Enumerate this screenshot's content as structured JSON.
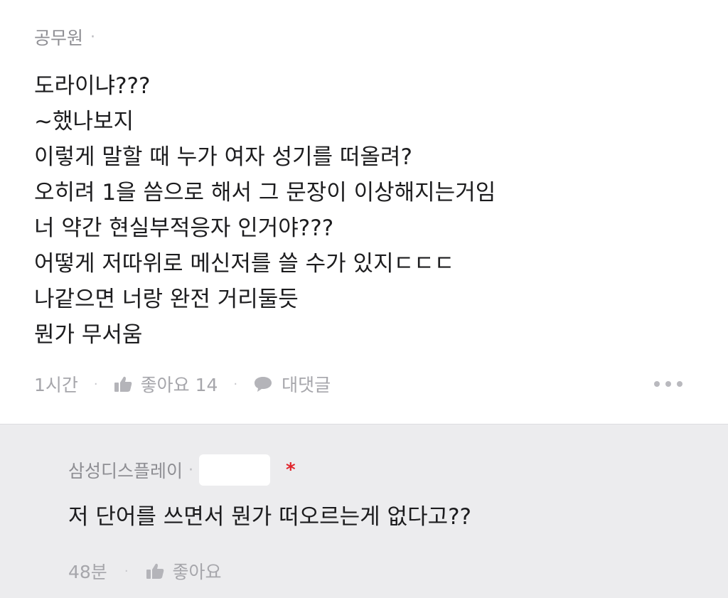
{
  "comment": {
    "author": "공무원",
    "separator": "·",
    "lines": [
      "도라이냐???",
      "~했나보지",
      "이렇게 말할 때 누가 여자 성기를 떠올려?",
      "오히려 1을 씀으로 해서 그 문장이 이상해지는거임",
      "너 약간 현실부적응자 인거야???",
      "어떻게 저따위로 메신저를 쓸 수가 있지ㄷㄷㄷ",
      "나같으면 너랑 완전 거리둘듯",
      "뭔가 무서움"
    ],
    "time": "1시간",
    "like_label": "좋아요 14",
    "reply_label": "대댓글",
    "like_icon": "thumbs-up-icon",
    "reply_icon": "speech-bubble-icon",
    "more_icon": "more-horizontal-icon"
  },
  "reply": {
    "author": "삼성디스플레이",
    "separator": "·",
    "verified_mark": "*",
    "text": "저 단어를 쓰면서 뭔가 떠오르는게 없다고??",
    "time": "48분",
    "like_label": "좋아요",
    "like_icon": "thumbs-up-icon"
  },
  "colors": {
    "reply_background": "#ececee",
    "meta_text": "#a6a6ab",
    "body_text": "#1c1c1e",
    "verified_mark": "#e0242b"
  }
}
